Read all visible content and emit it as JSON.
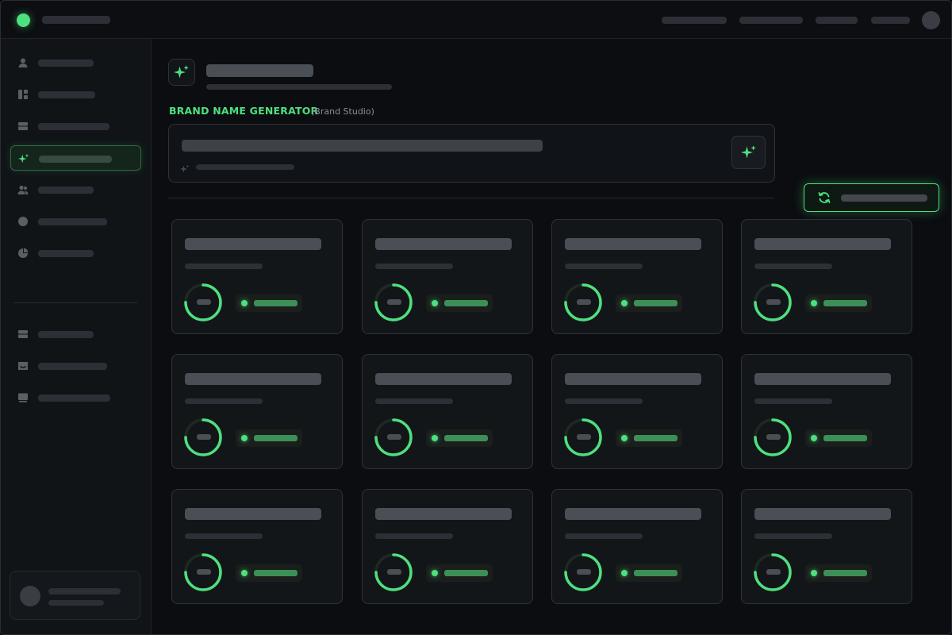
{
  "section": {
    "label": "BRAND NAME GENERATOR",
    "context": "(Brand Studio)"
  },
  "colors": {
    "accent": "#4ee07f",
    "background": "#0b0d10",
    "surface": "#131619",
    "border": "#2f3339"
  },
  "icons": {
    "header": "sparkles-icon",
    "generate": "sparkles-icon",
    "regenerate": "refresh-icon",
    "sidebar": [
      "user-icon",
      "dashboard-icon",
      "table-icon",
      "sparkles-icon",
      "users-icon",
      "circle-icon",
      "pie-chart-icon",
      "table-icon",
      "inbox-icon",
      "monitor-icon"
    ]
  },
  "sidebar": {
    "active_index": 3
  },
  "results": {
    "cards": [
      {
        "score": 0.75
      },
      {
        "score": 0.75
      },
      {
        "score": 0.75
      },
      {
        "score": 0.75
      },
      {
        "score": 0.75
      },
      {
        "score": 0.75
      },
      {
        "score": 0.75
      },
      {
        "score": 0.75
      },
      {
        "score": 0.75
      },
      {
        "score": 0.75
      },
      {
        "score": 0.75
      },
      {
        "score": 0.75
      }
    ]
  }
}
